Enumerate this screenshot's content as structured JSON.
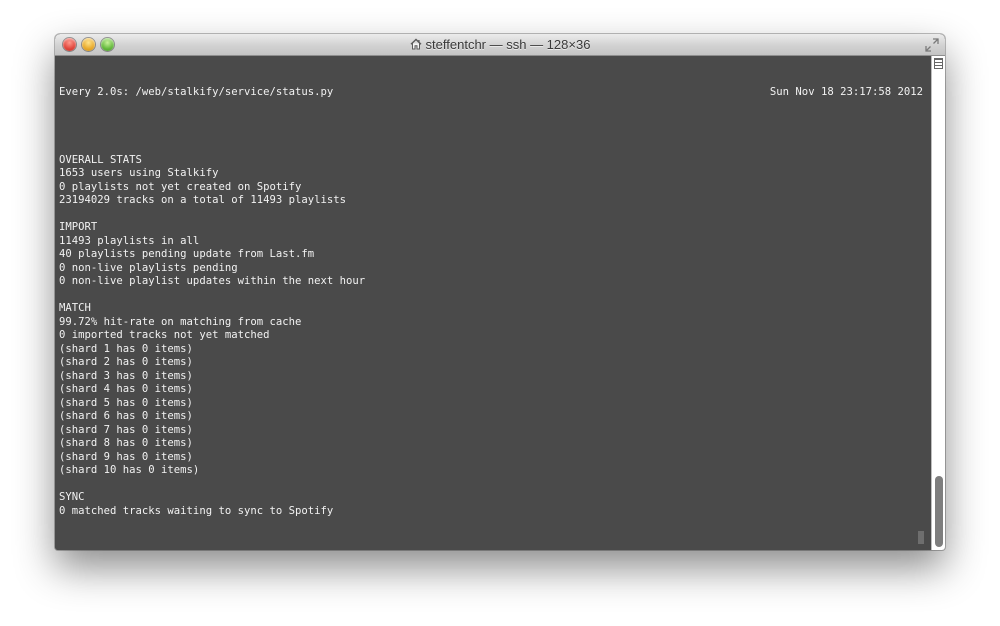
{
  "window": {
    "title": "steffentchr — ssh — 128×36"
  },
  "terminal": {
    "header_left": "Every 2.0s: /web/stalkify/service/status.py",
    "header_right": "Sun Nov 18 23:17:58 2012",
    "lines": [
      "",
      "",
      "OVERALL STATS",
      "1653 users using Stalkify",
      "0 playlists not yet created on Spotify",
      "23194029 tracks on a total of 11493 playlists",
      "",
      "IMPORT",
      "11493 playlists in all",
      "40 playlists pending update from Last.fm",
      "0 non-live playlists pending",
      "0 non-live playlist updates within the next hour",
      "",
      "MATCH",
      "99.72% hit-rate on matching from cache",
      "0 imported tracks not yet matched",
      "(shard 1 has 0 items)",
      "(shard 2 has 0 items)",
      "(shard 3 has 0 items)",
      "(shard 4 has 0 items)",
      "(shard 5 has 0 items)",
      "(shard 6 has 0 items)",
      "(shard 7 has 0 items)",
      "(shard 8 has 0 items)",
      "(shard 9 has 0 items)",
      "(shard 10 has 0 items)",
      "",
      "SYNC",
      "0 matched tracks waiting to sync to Spotify"
    ]
  },
  "colors": {
    "terminal_bg": "#4a4a4a",
    "terminal_fg": "#f2f2f2",
    "close": "#e0443a",
    "minimize": "#e8a92a",
    "zoom": "#62b83a"
  },
  "icons": {
    "title_icon": "home-icon",
    "fullscreen": "fullscreen-icon",
    "scroll_marker": "scroll-top-icon"
  }
}
